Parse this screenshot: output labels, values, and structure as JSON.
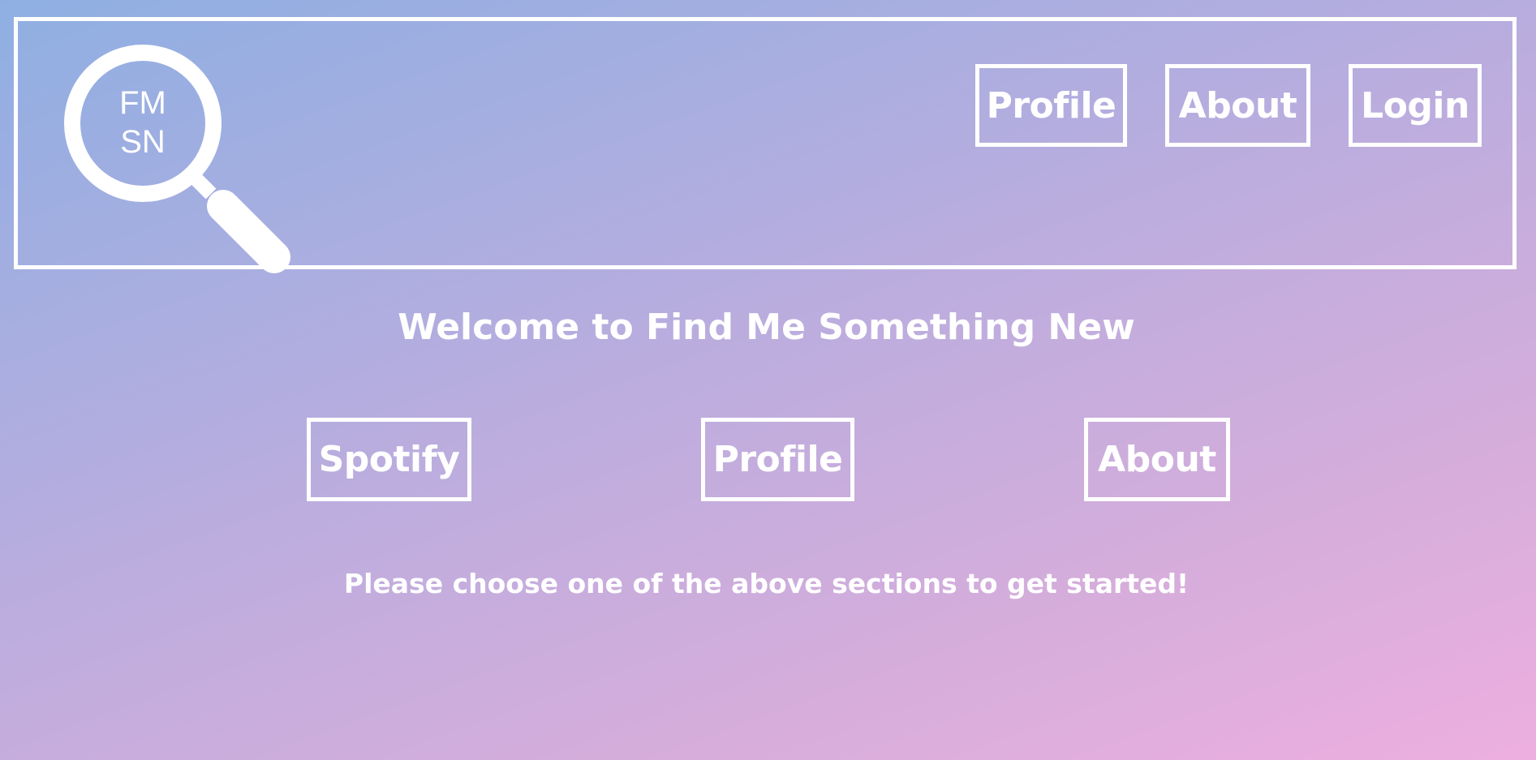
{
  "header": {
    "logo": {
      "icon": "magnifying-glass-icon",
      "line1": "FM",
      "line2": "SN"
    },
    "nav": {
      "profile_label": "Profile",
      "about_label": "About",
      "login_label": "Login"
    }
  },
  "main": {
    "welcome": "Welcome to Find Me Something New",
    "buttons": {
      "spotify_label": "Spotify",
      "profile_label": "Profile",
      "about_label": "About"
    },
    "prompt": "Please choose one of the above sections to get started!"
  },
  "colors": {
    "gradient_start": "#8fafe2",
    "gradient_end": "#edafdf",
    "foreground": "#ffffff"
  }
}
